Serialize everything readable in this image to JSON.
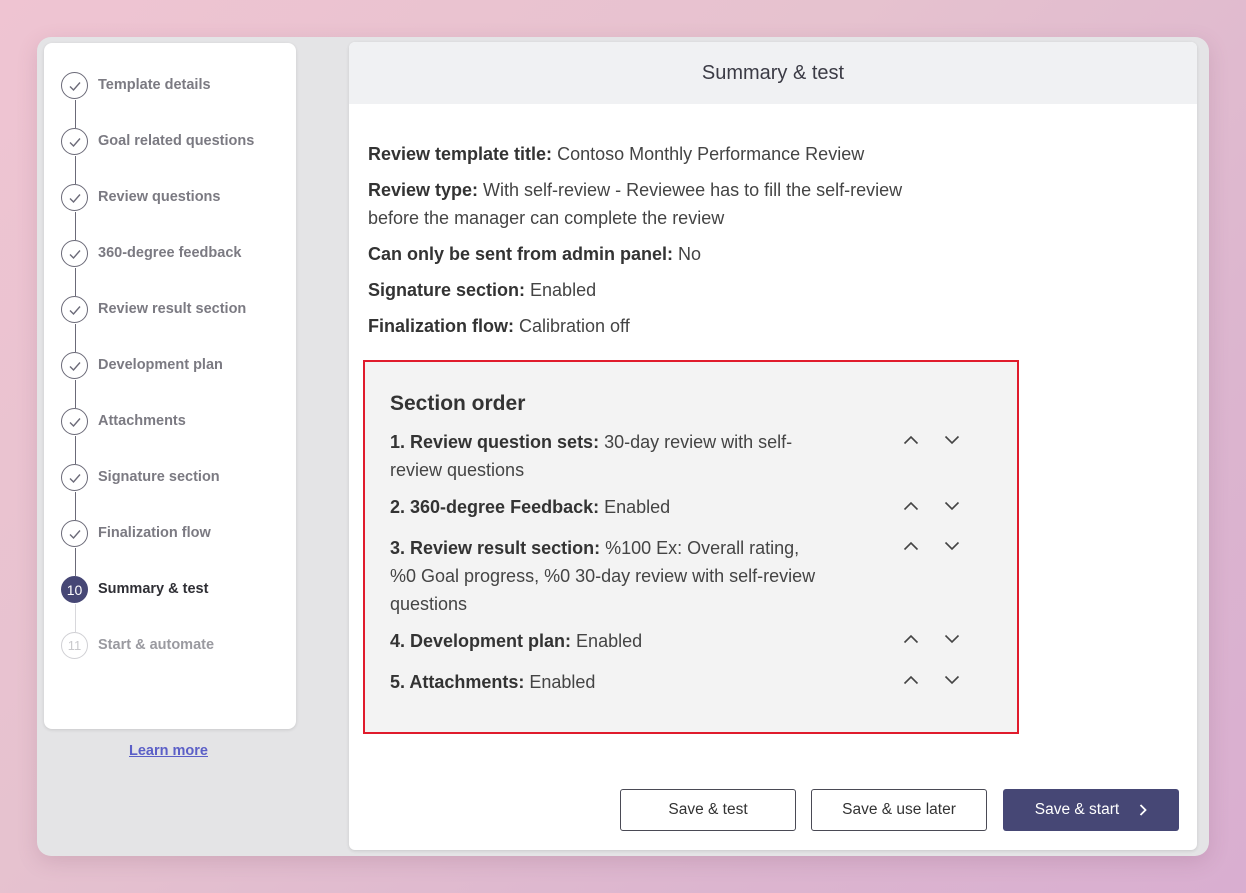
{
  "sidebar": {
    "steps": [
      {
        "label": "Template details"
      },
      {
        "label": "Goal related questions"
      },
      {
        "label": "Review questions"
      },
      {
        "label": "360-degree feedback"
      },
      {
        "label": "Review result section"
      },
      {
        "label": "Development plan"
      },
      {
        "label": "Attachments"
      },
      {
        "label": "Signature section"
      },
      {
        "label": "Finalization flow"
      },
      {
        "label": "Summary & test",
        "number": "10"
      },
      {
        "label": "Start & automate",
        "number": "11"
      }
    ],
    "learn_more": "Learn more"
  },
  "main": {
    "title": "Summary & test",
    "info": {
      "template_title_label": "Review template title:",
      "template_title_value": " Contoso Monthly Performance Review",
      "review_type_label": "Review type:",
      "review_type_value": " With self-review - Reviewee has to fill the self-review before the manager can complete the review",
      "admin_panel_label": "Can only be sent from admin panel:",
      "admin_panel_value": " No",
      "signature_label": "Signature section:",
      "signature_value": " Enabled",
      "finalization_label": "Finalization flow:",
      "finalization_value": " Calibration off"
    },
    "section_order": {
      "title": "Section order",
      "items": [
        {
          "label": "1. Review question sets:",
          "value": " 30-day review with self-review questions"
        },
        {
          "label": "2. 360-degree Feedback:",
          "value": " Enabled"
        },
        {
          "label": "3. Review result section:",
          "value": " %100 Ex: Overall rating, %0 Goal progress, %0 30-day review with self-review questions"
        },
        {
          "label": "4. Development plan:",
          "value": " Enabled"
        },
        {
          "label": "5. Attachments:",
          "value": " Enabled"
        }
      ]
    },
    "buttons": {
      "save_test": "Save & test",
      "save_later": "Save & use later",
      "save_start": "Save & start"
    }
  },
  "colors": {
    "accent": "#464775",
    "highlight_border": "#e01b2c",
    "link": "#5b5fc7"
  },
  "icons": {
    "completed_step": "check-icon",
    "move_up": "chevron-up-icon",
    "move_down": "chevron-down-icon",
    "next": "chevron-right-icon"
  }
}
